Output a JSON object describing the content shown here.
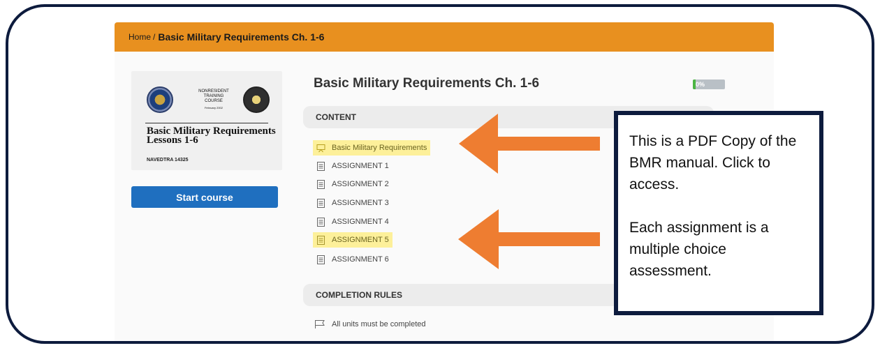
{
  "breadcrumb": {
    "home": "Home",
    "separator": "/",
    "current": "Basic Military Requirements Ch. 1-6"
  },
  "course": {
    "title": "Basic Military Requirements Ch. 1-6",
    "progress_percent": 0,
    "progress_label": "0%",
    "start_label": "Start course"
  },
  "cover": {
    "header_lines": [
      "NONRESIDENT",
      "TRAINING",
      "COURSE"
    ],
    "date": "February 2002",
    "title": "Basic Military Requirements Lessons 1-6",
    "code": "NAVEDTRA 14325"
  },
  "content": {
    "heading": "CONTENT",
    "units": [
      {
        "label": "Basic Military Requirements",
        "icon": "presentation-icon",
        "highlighted": true
      },
      {
        "label": "ASSIGNMENT 1",
        "icon": "document-icon",
        "highlighted": false
      },
      {
        "label": "ASSIGNMENT 2",
        "icon": "document-icon",
        "highlighted": false
      },
      {
        "label": "ASSIGNMENT 3",
        "icon": "document-icon",
        "highlighted": false
      },
      {
        "label": "ASSIGNMENT 4",
        "icon": "document-icon",
        "highlighted": false
      },
      {
        "label": "ASSIGNMENT 5",
        "icon": "document-icon",
        "highlighted": true
      },
      {
        "label": "ASSIGNMENT 6",
        "icon": "document-icon",
        "highlighted": false
      }
    ]
  },
  "completion": {
    "heading": "COMPLETION RULES",
    "rule": "All units must be completed",
    "icon": "flag-icon"
  },
  "annotation": {
    "paragraph1": "This is a PDF Copy of the BMR manual. Click to access.",
    "paragraph2": "Each assignment is a multiple choice assessment.",
    "arrow_color": "#ee7d31",
    "border_color": "#0d1b3d"
  },
  "colors": {
    "breadcrumb_bar": "#e8901f",
    "start_button": "#1f6fbf",
    "highlight": "#fdf09a",
    "progress_fill": "#4bb543"
  }
}
